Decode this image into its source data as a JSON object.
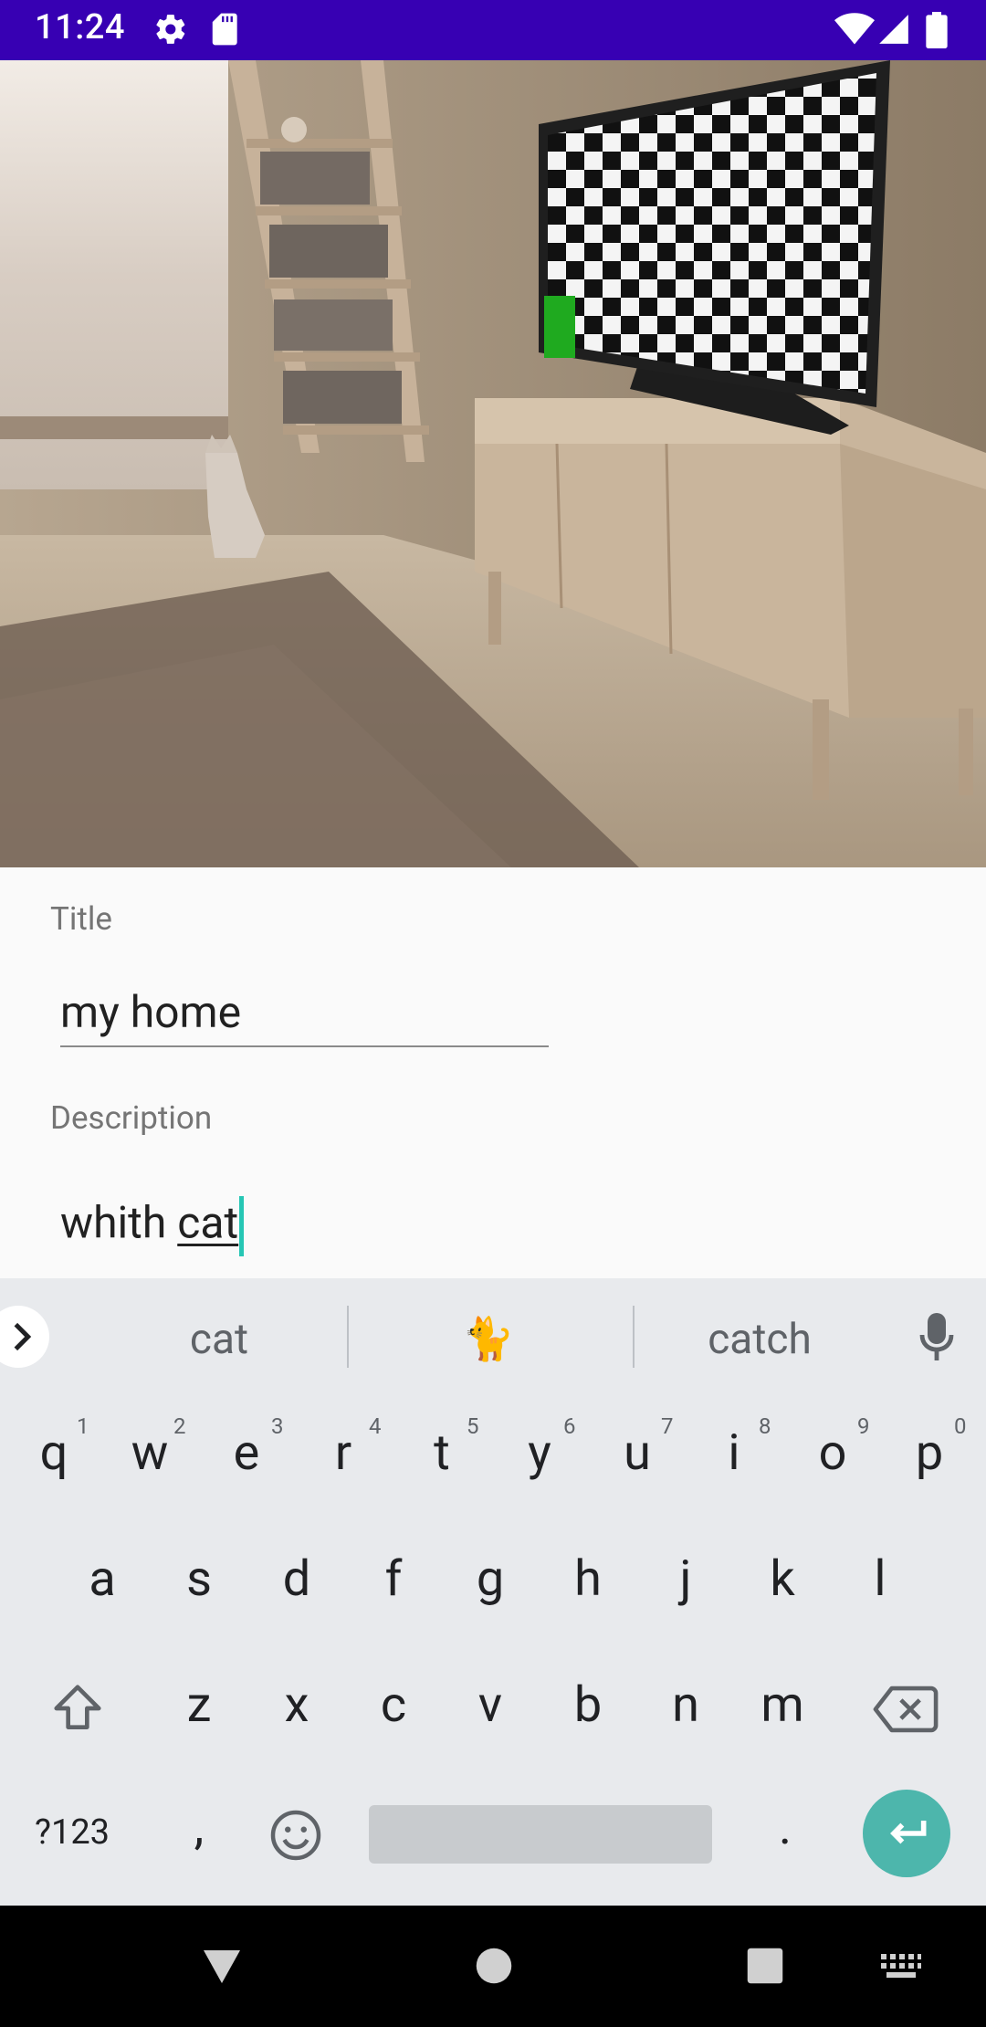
{
  "status_bar": {
    "time": "11:24",
    "background": "#3700b3"
  },
  "photo": {
    "icon": "living-room-photo"
  },
  "form": {
    "title_label": "Title",
    "title_value": "my home",
    "description_label": "Description",
    "description_prefix": "whith ",
    "description_composing": "cat"
  },
  "keyboard": {
    "suggestions": [
      "cat",
      "🐈",
      "catch"
    ],
    "row1": [
      {
        "key": "q",
        "hint": "1"
      },
      {
        "key": "w",
        "hint": "2"
      },
      {
        "key": "e",
        "hint": "3"
      },
      {
        "key": "r",
        "hint": "4"
      },
      {
        "key": "t",
        "hint": "5"
      },
      {
        "key": "y",
        "hint": "6"
      },
      {
        "key": "u",
        "hint": "7"
      },
      {
        "key": "i",
        "hint": "8"
      },
      {
        "key": "o",
        "hint": "9"
      },
      {
        "key": "p",
        "hint": "0"
      }
    ],
    "row2": [
      "a",
      "s",
      "d",
      "f",
      "g",
      "h",
      "j",
      "k",
      "l"
    ],
    "row3": [
      "z",
      "x",
      "c",
      "v",
      "b",
      "n",
      "m"
    ],
    "symbols_label": "?123",
    "comma": ",",
    "period": ".",
    "enter_color": "#4db6ac"
  },
  "accent_color": "#26c6b4"
}
